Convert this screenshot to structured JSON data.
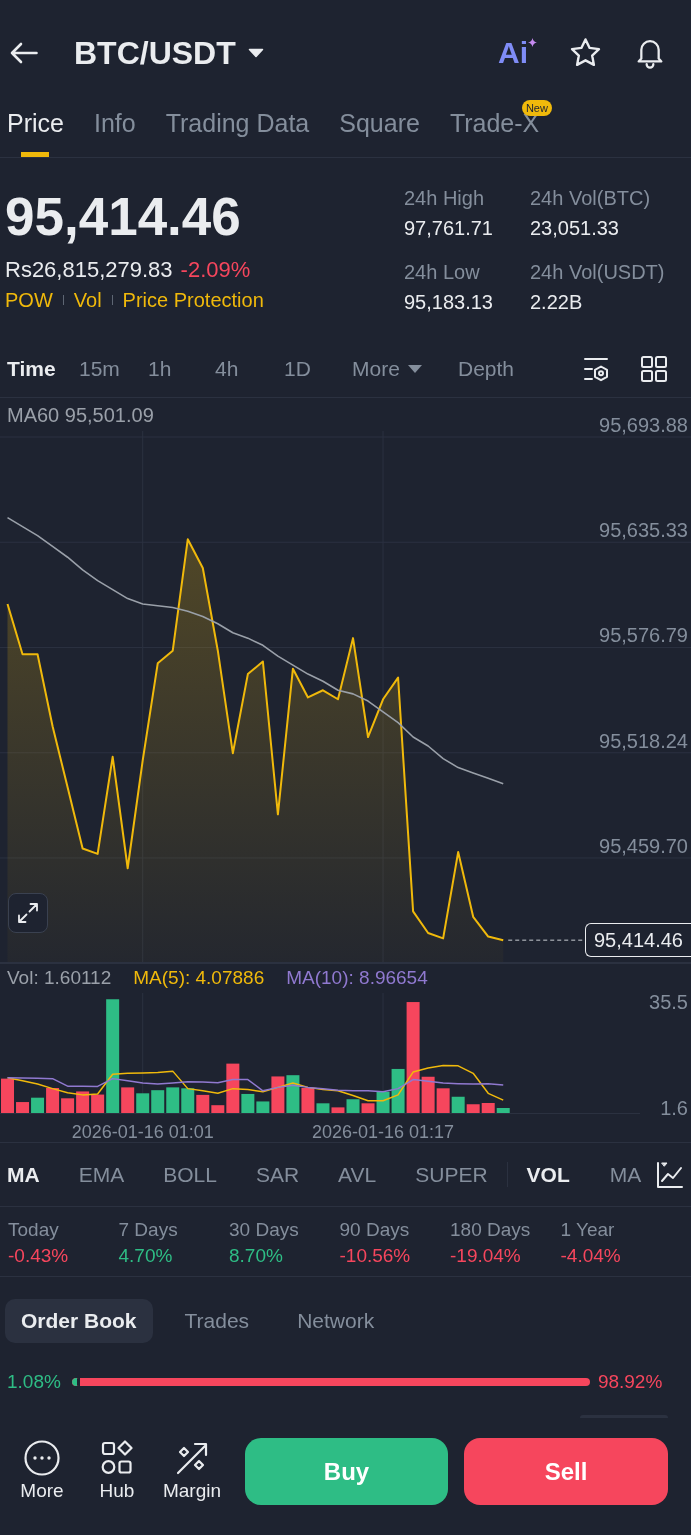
{
  "header": {
    "title": "BTC/USDT",
    "ai_label": "Ai"
  },
  "tabs": [
    {
      "label": "Price",
      "selected": true
    },
    {
      "label": "Info",
      "selected": false
    },
    {
      "label": "Trading Data",
      "selected": false
    },
    {
      "label": "Square",
      "selected": false
    },
    {
      "label": "Trade-X",
      "selected": false,
      "badge": "New"
    }
  ],
  "ticker": {
    "last_price": "95,414.46",
    "fiat_price": "Rs26,815,279.83",
    "change": {
      "text": "-2.09%",
      "color": "#f6465d"
    },
    "tags": [
      "POW",
      "Vol",
      "Price Protection"
    ],
    "stats": [
      {
        "label": "24h High",
        "value": "97,761.71"
      },
      {
        "label": "24h Vol(BTC)",
        "value": "23,051.33"
      },
      {
        "label": "24h Low",
        "value": "95,183.13"
      },
      {
        "label": "24h Vol(USDT)",
        "value": "2.22B"
      }
    ]
  },
  "intervals": [
    {
      "label": "Time",
      "kind": "option",
      "selected": true
    },
    {
      "label": "15m",
      "kind": "option",
      "selected": false
    },
    {
      "label": "1h",
      "kind": "option",
      "selected": false
    },
    {
      "label": "4h",
      "kind": "option",
      "selected": false
    },
    {
      "label": "1D",
      "kind": "option",
      "selected": false
    },
    {
      "label": "More",
      "kind": "dropdown",
      "selected": false
    },
    {
      "label": "Depth",
      "kind": "option",
      "selected": false
    }
  ],
  "price_chart": {
    "ma_label": "MA60 95,501.09",
    "current_price": "95,414.46",
    "chart_data": {
      "type": "area",
      "grid": true,
      "series": [
        {
          "color": "#f0b90b",
          "values": [
            95601,
            95573,
            95573,
            95533,
            95499,
            95465,
            95462,
            95516,
            95454,
            95514,
            95568,
            95575,
            95637,
            95621,
            95575,
            95518,
            95562,
            95569,
            95484,
            95565,
            95549,
            95553,
            95548,
            95582,
            95527,
            95548,
            95560,
            95430,
            95418,
            95415,
            95463,
            95427,
            95416,
            95414,
            null,
            null,
            null,
            null,
            null,
            null,
            null,
            null,
            null,
            null,
            null,
            null
          ]
        },
        {
          "type": "line",
          "color": "#9aa0a9",
          "values": [
            95649,
            95644,
            95639,
            95633,
            95627,
            95620,
            95614,
            95609,
            95604,
            95601,
            95600,
            95599,
            95597,
            95594,
            95590,
            95585,
            95582,
            95578,
            95572,
            95567,
            95562,
            95558,
            95553,
            95551,
            95547,
            95541,
            95535,
            95527,
            95522,
            95515,
            95510,
            95507,
            95504,
            95501,
            null,
            null,
            null,
            null,
            null,
            null,
            null,
            null,
            null,
            null,
            null,
            null
          ]
        }
      ],
      "ylim": [
        95401.85,
        95716.13
      ],
      "yticks": [
        {
          "value": 95459.7,
          "label": "95,459.70"
        },
        {
          "value": 95518.24,
          "label": "95,518.24"
        },
        {
          "value": 95576.79,
          "label": "95,576.79"
        },
        {
          "value": 95635.33,
          "label": "95,635.33"
        },
        {
          "value": 95693.88,
          "label": "95,693.88"
        }
      ]
    }
  },
  "volume_chart": {
    "legend": [
      {
        "text": "Vol: 1.60112",
        "color": "#9aa0a9"
      },
      {
        "text": "MA(5): 4.07886",
        "color": "#f0b90b"
      },
      {
        "text": "MA(10): 8.96654",
        "color": "#9079d0"
      }
    ],
    "chart_data": {
      "type": "bar",
      "grid": true,
      "categories": [
        null,
        null,
        null,
        null,
        null,
        null,
        null,
        null,
        null,
        "2026-01-16 01:01",
        null,
        null,
        null,
        null,
        null,
        null,
        null,
        null,
        null,
        null,
        null,
        null,
        null,
        null,
        null,
        "2026-01-16 01:17",
        null,
        null,
        null,
        null,
        null,
        null,
        null,
        null,
        null,
        null,
        null,
        null,
        null,
        null,
        null,
        null,
        null,
        null,
        null,
        null
      ],
      "series": [
        {
          "colors": [
            "#f6465d",
            "#f6465d",
            "#2ebd85",
            "#f6465d",
            "#f6465d",
            "#f6465d",
            "#f6465d",
            "#2ebd85",
            "#f6465d",
            "#2ebd85",
            "#2ebd85",
            "#2ebd85",
            "#2ebd85",
            "#f6465d",
            "#f6465d",
            "#f6465d",
            "#2ebd85",
            "#2ebd85",
            "#f6465d",
            "#2ebd85",
            "#f6465d",
            "#2ebd85",
            "#f6465d",
            "#2ebd85",
            "#f6465d",
            "#2ebd85",
            "#2ebd85",
            "#f6465d",
            "#f6465d",
            "#f6465d",
            "#2ebd85",
            "#f6465d",
            "#f6465d",
            "#2ebd85",
            null,
            null,
            null,
            null,
            null,
            null,
            null,
            null,
            null,
            null,
            null,
            null
          ],
          "values": [
            11,
            3.5,
            4.9,
            8,
            4.7,
            6.9,
            5.9,
            36.4,
            8.2,
            6.3,
            7.3,
            8.2,
            7.9,
            5.8,
            2.5,
            15.8,
            6.1,
            3.7,
            11.7,
            12.1,
            8,
            3.1,
            1.8,
            4.4,
            3.1,
            6.8,
            14.1,
            35.5,
            11.6,
            7.9,
            5.2,
            2.8,
            3.2,
            1.6,
            null,
            null,
            null,
            null,
            null,
            null,
            null,
            null,
            null,
            null,
            null,
            null
          ]
        },
        {
          "type": "line",
          "color": "#f0b90b",
          "values": [
            11.3,
            10.3,
            9.3,
            7.8,
            6.5,
            5.8,
            6.1,
            12.4,
            12.7,
            12.8,
            13,
            13.4,
            7.8,
            7.1,
            6.3,
            7.8,
            7.5,
            6.8,
            8.2,
            9.6,
            8.2,
            7.5,
            7.1,
            5.6,
            3.9,
            3.9,
            5.8,
            13.1,
            14.4,
            15.2,
            15.1,
            12.7,
            6.3,
            4.1,
            null,
            null,
            null,
            null,
            null,
            null,
            null,
            null,
            null,
            null,
            null,
            null
          ]
        },
        {
          "type": "line",
          "color": "#9079d0",
          "values": [
            11.3,
            11.2,
            11.1,
            11,
            8.6,
            8.6,
            8.5,
            11,
            10.3,
            9.6,
            9.3,
            9.6,
            10,
            9.9,
            9.7,
            10.7,
            10.7,
            7.1,
            8.2,
            8.9,
            8.2,
            7.8,
            7.3,
            7.1,
            7.1,
            6.8,
            7.8,
            10.7,
            10.2,
            9.6,
            9.4,
            9.3,
            9.4,
            9,
            null,
            null,
            null,
            null,
            null,
            null,
            null,
            null,
            null,
            null,
            null,
            null
          ]
        }
      ],
      "ylim": [
        0,
        48
      ],
      "yticks": [
        {
          "value": 1.6,
          "label": "1.6"
        },
        {
          "value": 35.5,
          "label": "35.5"
        }
      ]
    }
  },
  "main_indicators": [
    {
      "label": "MA",
      "selected": true
    },
    {
      "label": "EMA",
      "selected": false
    },
    {
      "label": "BOLL",
      "selected": false
    },
    {
      "label": "SAR",
      "selected": false
    },
    {
      "label": "AVL",
      "selected": false
    },
    {
      "label": "SUPER",
      "selected": false
    }
  ],
  "sub_indicators": [
    {
      "label": "VOL",
      "selected": true
    },
    {
      "label": "MA",
      "selected": false
    }
  ],
  "performance": [
    {
      "label": "Today",
      "value": "-0.43%",
      "color": "#f6465d"
    },
    {
      "label": "7 Days",
      "value": "4.70%",
      "color": "#2ebd85"
    },
    {
      "label": "30 Days",
      "value": "8.70%",
      "color": "#2ebd85"
    },
    {
      "label": "90 Days",
      "value": "-10.56%",
      "color": "#f6465d"
    },
    {
      "label": "180 Days",
      "value": "-19.04%",
      "color": "#f6465d"
    },
    {
      "label": "1 Year",
      "value": "-4.04%",
      "color": "#f6465d"
    }
  ],
  "order_tabs": [
    {
      "label": "Order Book",
      "selected": true
    },
    {
      "label": "Trades",
      "selected": false
    },
    {
      "label": "Network",
      "selected": false
    }
  ],
  "order_ratio": {
    "bid": "1.08%",
    "ask": "98.92%",
    "level": 0.0108
  },
  "bottom_bar": {
    "actions": [
      {
        "label": "More"
      },
      {
        "label": "Hub"
      },
      {
        "label": "Margin"
      }
    ],
    "trade_buttons": [
      {
        "label": "Buy",
        "kind": "buy"
      },
      {
        "label": "Sell",
        "kind": "sell"
      }
    ]
  }
}
